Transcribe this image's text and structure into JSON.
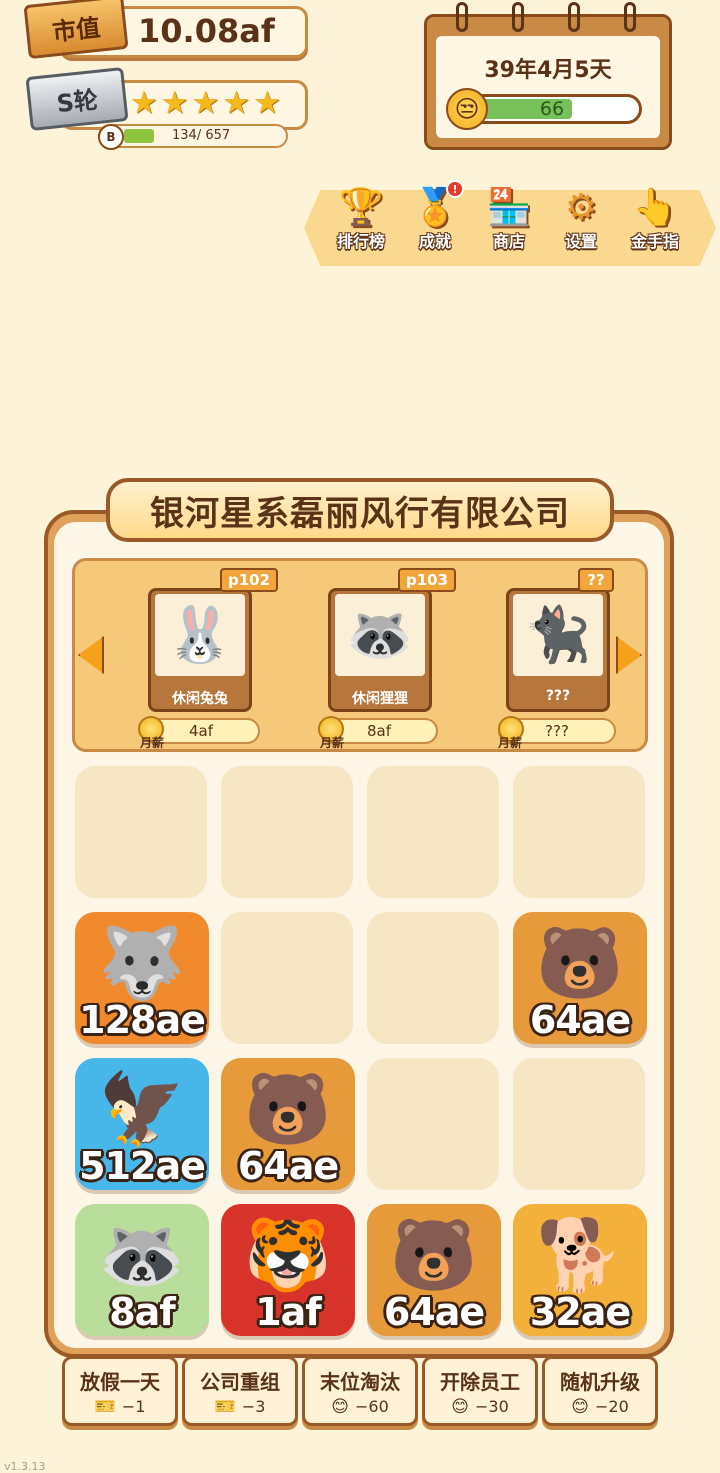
{
  "stats": {
    "market_value_label": "市值",
    "market_value": "10.08af",
    "rank_label": "S轮",
    "stars": [
      "★",
      "★",
      "★",
      "★",
      "★"
    ],
    "xp_badge": "B",
    "xp_text": "134/ 657",
    "xp_progress": 0.2
  },
  "calendar": {
    "date": "39年4月5天",
    "mood_value": "66",
    "mood_icon": "neutral-face-icon"
  },
  "menu": [
    {
      "label": "排行榜",
      "icon": "trophy-icon",
      "glyph": "🏆"
    },
    {
      "label": "成就",
      "icon": "medal-icon",
      "glyph": "🏅",
      "badge": "!"
    },
    {
      "label": "商店",
      "icon": "shop-icon",
      "glyph": "🏪"
    },
    {
      "label": "设置",
      "icon": "gear-icon",
      "glyph": "⚙"
    },
    {
      "label": "金手指",
      "icon": "golden-finger-icon",
      "glyph": "👆"
    }
  ],
  "company": {
    "name": "银河星系磊丽风行有限公司"
  },
  "employees": [
    {
      "tag": "p102",
      "name": "休闲兔兔",
      "salary_label": "月薪",
      "salary": "4af",
      "art": "rabbit-icon",
      "glyph": "🐰"
    },
    {
      "tag": "p103",
      "name": "休闲狸狸",
      "salary_label": "月薪",
      "salary": "8af",
      "art": "red-panda-icon",
      "glyph": "🦝"
    },
    {
      "tag": "??",
      "name": "???",
      "salary_label": "月薪",
      "salary": "???",
      "art": "locked-silhouette-icon",
      "glyph": "🐈‍⬛"
    }
  ],
  "grid": [
    {
      "r": 0,
      "c": 0,
      "label": null
    },
    {
      "r": 0,
      "c": 1,
      "label": null
    },
    {
      "r": 0,
      "c": 2,
      "label": null
    },
    {
      "r": 0,
      "c": 3,
      "label": null
    },
    {
      "r": 1,
      "c": 0,
      "label": "128ae",
      "bg": "#f08a2c",
      "glyph": "🐺",
      "name": "wolf"
    },
    {
      "r": 1,
      "c": 1,
      "label": null
    },
    {
      "r": 1,
      "c": 2,
      "label": null
    },
    {
      "r": 1,
      "c": 3,
      "label": "64ae",
      "bg": "#e79a3a",
      "glyph": "🐻",
      "name": "bear"
    },
    {
      "r": 2,
      "c": 0,
      "label": "512ae",
      "bg": "#47b7ea",
      "glyph": "🦅",
      "name": "eagle"
    },
    {
      "r": 2,
      "c": 1,
      "label": "64ae",
      "bg": "#e79a3a",
      "glyph": "🐻",
      "name": "bear"
    },
    {
      "r": 2,
      "c": 2,
      "label": null
    },
    {
      "r": 2,
      "c": 3,
      "label": null
    },
    {
      "r": 3,
      "c": 0,
      "label": "8af",
      "bg": "#b9dd9a",
      "glyph": "🦝",
      "name": "red-panda"
    },
    {
      "r": 3,
      "c": 1,
      "label": "1af",
      "bg": "#d8332a",
      "glyph": "🐯",
      "name": "tiger"
    },
    {
      "r": 3,
      "c": 2,
      "label": "64ae",
      "bg": "#e79a3a",
      "glyph": "🐻",
      "name": "bear"
    },
    {
      "r": 3,
      "c": 3,
      "label": "32ae",
      "bg": "#f3b13c",
      "glyph": "🐕",
      "name": "shiba"
    }
  ],
  "actions": [
    {
      "label": "放假一天",
      "cost": "−1",
      "cost_icon": "ticket-icon",
      "glyph": "🎫"
    },
    {
      "label": "公司重组",
      "cost": "−3",
      "cost_icon": "ticket-icon",
      "glyph": "🎫"
    },
    {
      "label": "末位淘汰",
      "cost": "−60",
      "cost_icon": "smile-icon",
      "glyph": "😊"
    },
    {
      "label": "开除员工",
      "cost": "−30",
      "cost_icon": "smile-icon",
      "glyph": "😊"
    },
    {
      "label": "随机升级",
      "cost": "−20",
      "cost_icon": "smile-icon",
      "glyph": "😊"
    }
  ],
  "version": "v1.3.13"
}
